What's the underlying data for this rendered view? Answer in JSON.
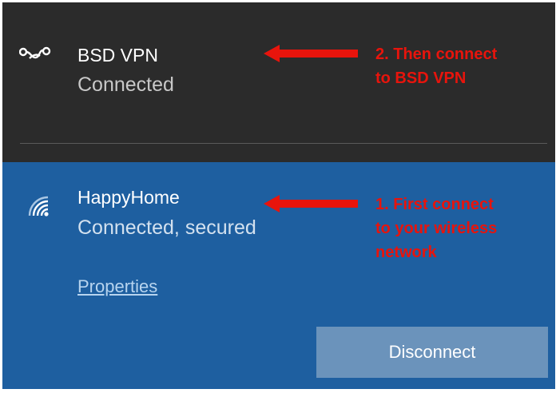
{
  "vpn": {
    "name": "BSD VPN",
    "status": "Connected",
    "icon": "vpn-icon"
  },
  "wifi": {
    "name": "HappyHome",
    "status": "Connected, secured",
    "icon": "wifi-signal-icon",
    "properties_label": "Properties",
    "disconnect_label": "Disconnect"
  },
  "annotations": {
    "step2": "2. Then connect\nto BSD VPN",
    "step1": "1. First connect\nto your wireless\nnetwork"
  },
  "colors": {
    "vpn_background": "#2b2b2b",
    "wifi_background": "#1e5fa0",
    "button_background": "#6b93bb",
    "annotation_red": "#e8140c"
  }
}
